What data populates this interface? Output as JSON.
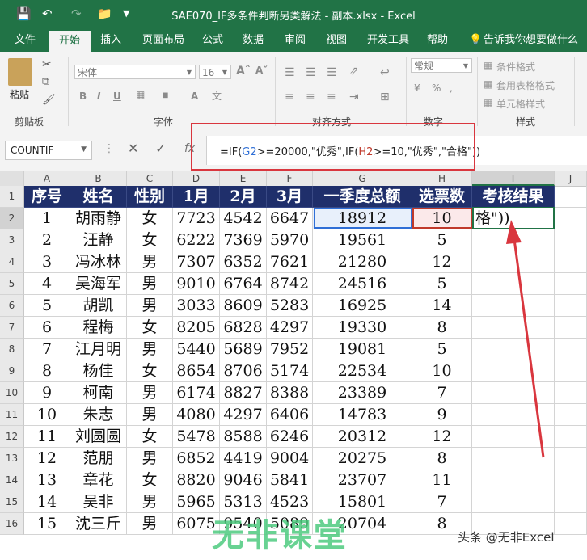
{
  "window": {
    "title": "SAE070_IF多条件判断另类解法 - 副本.xlsx  -  Excel"
  },
  "ribbon_tabs": [
    "文件",
    "开始",
    "插入",
    "页面布局",
    "公式",
    "数据",
    "审阅",
    "视图",
    "开发工具",
    "帮助",
    "告诉我你想要做什么"
  ],
  "ribbon": {
    "paste": "粘贴",
    "clipboard": "剪贴板",
    "font_name": "宋体",
    "font_size": "16",
    "font_group": "字体",
    "align_group": "对齐方式",
    "number_format": "常规",
    "number_group": "数字",
    "cond_format": "条件格式",
    "table_format": "套用表格格式",
    "cell_style": "单元格样式",
    "style_group": "样式"
  },
  "formula_bar": {
    "name_box": "COUNTIF",
    "fx": "fx",
    "formula_parts": [
      "=IF(",
      "G2",
      ">=20000,\"优秀\",IF(",
      "H2",
      ">=10,\"优秀\",\"合格\"))"
    ]
  },
  "columns": [
    "A",
    "B",
    "C",
    "D",
    "E",
    "F",
    "G",
    "H",
    "I",
    "J"
  ],
  "headers": [
    "序号",
    "姓名",
    "性别",
    "1月",
    "2月",
    "3月",
    "一季度总额",
    "选票数",
    "考核结果"
  ],
  "rows": [
    [
      "1",
      "胡雨静",
      "女",
      "7723",
      "4542",
      "6647",
      "18912",
      "10",
      "格\"))"
    ],
    [
      "2",
      "汪静",
      "女",
      "6222",
      "7369",
      "5970",
      "19561",
      "5",
      ""
    ],
    [
      "3",
      "冯冰林",
      "男",
      "7307",
      "6352",
      "7621",
      "21280",
      "12",
      ""
    ],
    [
      "4",
      "吴海军",
      "男",
      "9010",
      "6764",
      "8742",
      "24516",
      "5",
      ""
    ],
    [
      "5",
      "胡凯",
      "男",
      "3033",
      "8609",
      "5283",
      "16925",
      "14",
      ""
    ],
    [
      "6",
      "程梅",
      "女",
      "8205",
      "6828",
      "4297",
      "19330",
      "8",
      ""
    ],
    [
      "7",
      "江月明",
      "男",
      "5440",
      "5689",
      "7952",
      "19081",
      "5",
      ""
    ],
    [
      "8",
      "杨佳",
      "女",
      "8654",
      "8706",
      "5174",
      "22534",
      "10",
      ""
    ],
    [
      "9",
      "柯南",
      "男",
      "6174",
      "8827",
      "8388",
      "23389",
      "7",
      ""
    ],
    [
      "10",
      "朱志",
      "男",
      "4080",
      "4297",
      "6406",
      "14783",
      "9",
      ""
    ],
    [
      "11",
      "刘圆圆",
      "女",
      "5478",
      "8588",
      "6246",
      "20312",
      "12",
      ""
    ],
    [
      "12",
      "范朋",
      "男",
      "6852",
      "4419",
      "9004",
      "20275",
      "8",
      ""
    ],
    [
      "13",
      "章花",
      "女",
      "8820",
      "9046",
      "5841",
      "23707",
      "11",
      ""
    ],
    [
      "14",
      "吴非",
      "男",
      "5965",
      "5313",
      "4523",
      "15801",
      "7",
      ""
    ],
    [
      "15",
      "沈三斤",
      "男",
      "6075",
      "9540",
      "5089",
      "20704",
      "8",
      ""
    ]
  ],
  "watermark": {
    "logo": "无非课堂",
    "credit": "头条 @无非Excel"
  },
  "colors": {
    "excel_green": "#217346",
    "header_fill": "#1f2f6b",
    "g_ref": "#2f6fd6",
    "h_ref": "#c0392b",
    "annotation_red": "#d9363e"
  }
}
